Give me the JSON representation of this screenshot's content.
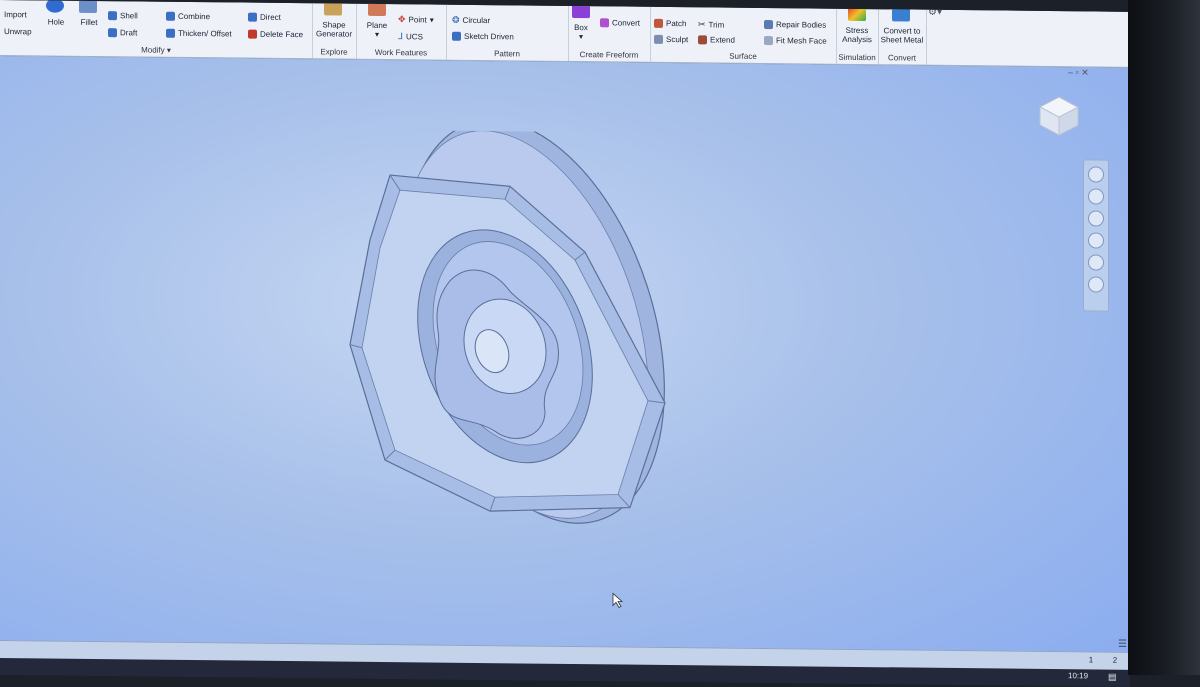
{
  "ribbon": {
    "panels": {
      "modify": {
        "label": "Modify",
        "import_label": "Import",
        "unwrap_label": "Unwrap",
        "hole_label": "Hole",
        "fillet_label": "Fillet",
        "shell_label": "Shell",
        "draft_label": "Draft",
        "combine_label": "Combine",
        "thicken_label": "Thicken/ Offset",
        "direct_label": "Direct",
        "delete_face_label": "Delete Face"
      },
      "explore": {
        "label": "Explore",
        "shape_generator_label": "Shape Generator"
      },
      "work_features": {
        "label": "Work Features",
        "plane_label": "Plane",
        "point_label": "Point",
        "ucs_label": "UCS"
      },
      "pattern": {
        "label": "Pattern",
        "circular_label": "Circular",
        "sketch_driven_label": "Sketch Driven"
      },
      "create_freeform": {
        "label": "Create Freeform",
        "box_label": "Box",
        "convert_label": "Convert"
      },
      "surface": {
        "label": "Surface",
        "patch_label": "Patch",
        "sculpt_label": "Sculpt",
        "trim_label": "Trim",
        "extend_label": "Extend",
        "repair_bodies_label": "Repair Bodies",
        "fit_mesh_face_label": "Fit Mesh Face"
      },
      "simulation": {
        "label": "Simulation",
        "stress_analysis_label": "Stress Analysis"
      },
      "convert": {
        "label": "Convert",
        "sheet_metal_label": "Convert to Sheet Metal"
      }
    }
  },
  "status": {
    "tab1": "1",
    "tab2": "2"
  },
  "taskbar": {
    "clock": "10:19"
  },
  "colors": {
    "viewport_top": "#c6d7f2",
    "viewport_bottom": "#8aacf0",
    "part_face": "#b7c9ec",
    "part_edge": "#5a6f98"
  }
}
